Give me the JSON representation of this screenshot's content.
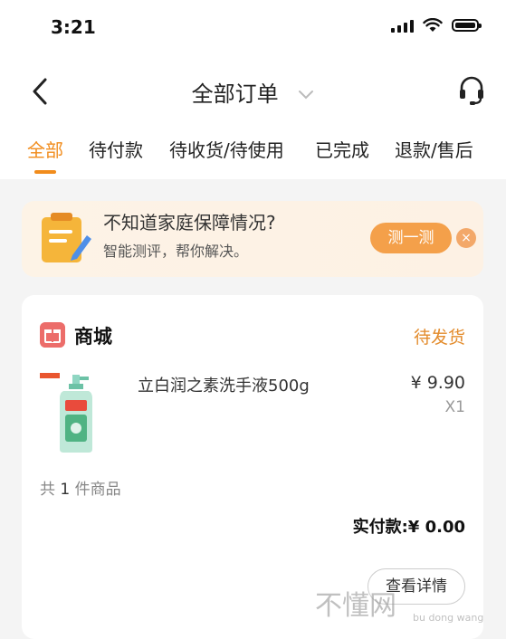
{
  "status_bar": {
    "time": "3:21"
  },
  "nav": {
    "title": "全部订单"
  },
  "tabs": [
    {
      "label": "全部",
      "active": true
    },
    {
      "label": "待付款"
    },
    {
      "label": "待收货/待使用"
    },
    {
      "label": "已完成"
    },
    {
      "label": "退款/售后"
    }
  ],
  "banner": {
    "title": "不知道家庭保障情况?",
    "subtitle": "智能测评，帮你解决。",
    "button_label": "测一测",
    "close_symbol": "×"
  },
  "order": {
    "store_name": "商城",
    "status": "待发货",
    "product": {
      "name": "立白润之素洗手液500g",
      "price": "¥ 9.90",
      "quantity": "X1",
      "image_icon": "hand-soap-bottle-icon"
    },
    "count_prefix": "共",
    "count_value": "1",
    "count_suffix": "件商品",
    "paid_label": "实付款:¥ 0.00",
    "detail_button": "查看详情"
  },
  "watermark": {
    "text": "不懂网",
    "sub": "bu dong wang"
  },
  "colors": {
    "accent": "#f18c1c",
    "store_icon": "#ec6d6a",
    "banner_button": "#f4a04a"
  }
}
